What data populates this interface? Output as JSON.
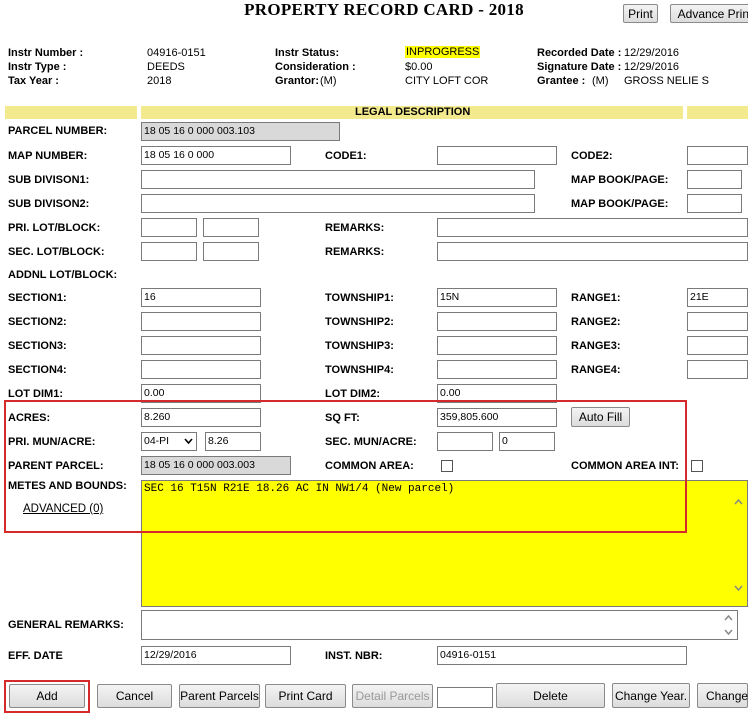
{
  "title": "PROPERTY RECORD CARD - 2018",
  "top_buttons": {
    "print": "Print",
    "advance_print": "Advance Print"
  },
  "header": {
    "instr_number_label": "Instr Number :",
    "instr_number": "04916-0151",
    "instr_type_label": "Instr Type :",
    "instr_type": "DEEDS",
    "tax_year_label": "Tax Year :",
    "tax_year": "2018",
    "instr_status_label": "Instr Status:",
    "instr_status": "INPROGRESS",
    "consideration_label": "Consideration :",
    "consideration": "$0.00",
    "grantor_label": "Grantor:",
    "grantor_prefix": "(M)",
    "grantor": "CITY LOFT COR",
    "recorded_date_label": "Recorded Date :",
    "recorded_date": "12/29/2016",
    "signature_date_label": "Signature Date :",
    "signature_date": "12/29/2016",
    "grantee_label": "Grantee :",
    "grantee_prefix": "(M)",
    "grantee": "GROSS NELIE S"
  },
  "section_title": "LEGAL DESCRIPTION",
  "labels": {
    "parcel_number": "PARCEL NUMBER:",
    "map_number": "MAP NUMBER:",
    "code1": "CODE1:",
    "code2": "CODE2:",
    "sub_division1": "SUB DIVISON1:",
    "sub_division2": "SUB DIVISON2:",
    "map_book_page": "MAP BOOK/PAGE:",
    "pri_lot_block": "PRI. LOT/BLOCK:",
    "sec_lot_block": "SEC. LOT/BLOCK:",
    "remarks": "REMARKS:",
    "addnl_lot_block": "ADDNL LOT/BLOCK:",
    "section1": "SECTION1:",
    "section2": "SECTION2:",
    "section3": "SECTION3:",
    "section4": "SECTION4:",
    "township1": "TOWNSHIP1:",
    "township2": "TOWNSHIP2:",
    "township3": "TOWNSHIP3:",
    "township4": "TOWNSHIP4:",
    "range1": "RANGE1:",
    "range2": "RANGE2:",
    "range3": "RANGE3:",
    "range4": "RANGE4:",
    "lot_dim1": "LOT DIM1:",
    "lot_dim2": "LOT DIM2:",
    "acres": "ACRES:",
    "sq_ft": "SQ FT:",
    "pri_mun_acre": "PRI. MUN/ACRE:",
    "sec_mun_acre": "SEC. MUN/ACRE:",
    "parent_parcel": "PARENT PARCEL:",
    "common_area": "COMMON AREA:",
    "common_area_int": "COMMON AREA INT:",
    "metes_and_bounds": "METES AND BOUNDS:",
    "advanced_link": "ADVANCED (0)",
    "general_remarks": "GENERAL REMARKS:",
    "eff_date": "EFF. DATE",
    "inst_nbr": "INST. NBR:"
  },
  "values": {
    "parcel_number": "18 05 16 0 000 003.103",
    "map_number": "18 05 16 0 000",
    "section1": "16",
    "township1": "15N",
    "range1": "21E",
    "lot_dim1": "0.00",
    "lot_dim2": "0.00",
    "acres": "8.260",
    "sq_ft": "359,805.600",
    "pri_mun_select": "04-PI",
    "pri_mun_acre": "8.26",
    "sec_mun_acre": "0",
    "parent_parcel": "18 05 16 0 000 003.003",
    "metes_and_bounds": "SEC 16 T15N R21E 18.26 AC IN NW1/4 (New parcel)",
    "eff_date": "12/29/2016",
    "inst_nbr": "04916-0151"
  },
  "auto_fill_button": "Auto Fill",
  "bottom_buttons": {
    "add": "Add",
    "cancel": "Cancel",
    "parent_parcels": "Parent Parcels",
    "print_card": "Print Card",
    "detail_parcels": "Detail Parcels",
    "delete": "Delete",
    "change_year": "Change Year.",
    "change": "Change"
  },
  "colors": {
    "highlight": "#ffff00",
    "band": "#f3e98d",
    "annotation_red": "#d42a2a",
    "readonly_gray": "#d9d9d9"
  }
}
